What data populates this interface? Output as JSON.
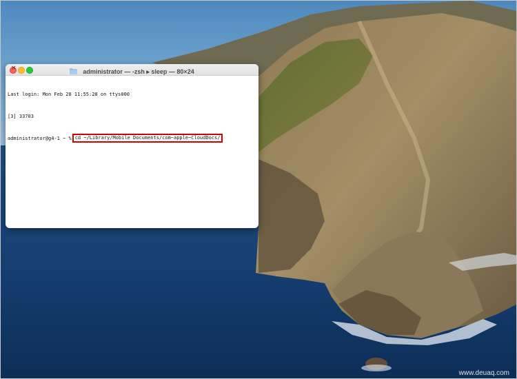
{
  "window": {
    "title": "administrator — -zsh ▸ sleep — 80×24"
  },
  "terminal": {
    "lines": [
      "Last login: Mon Feb 28 11:55:28 on ttys000",
      "[3] 33703"
    ],
    "prompt": "administrator@g4-1 ~ %",
    "command": "cd ~/Library/Mobile Documents/com~apple~CloudDocs/"
  },
  "watermark": "www.deuaq.com",
  "colors": {
    "highlight_border": "#d40000",
    "close": "#fe5f57",
    "minimize": "#febc2e",
    "maximize": "#28c840"
  },
  "icons": [
    "folder-icon",
    "close-icon",
    "minimize-icon",
    "maximize-icon"
  ]
}
